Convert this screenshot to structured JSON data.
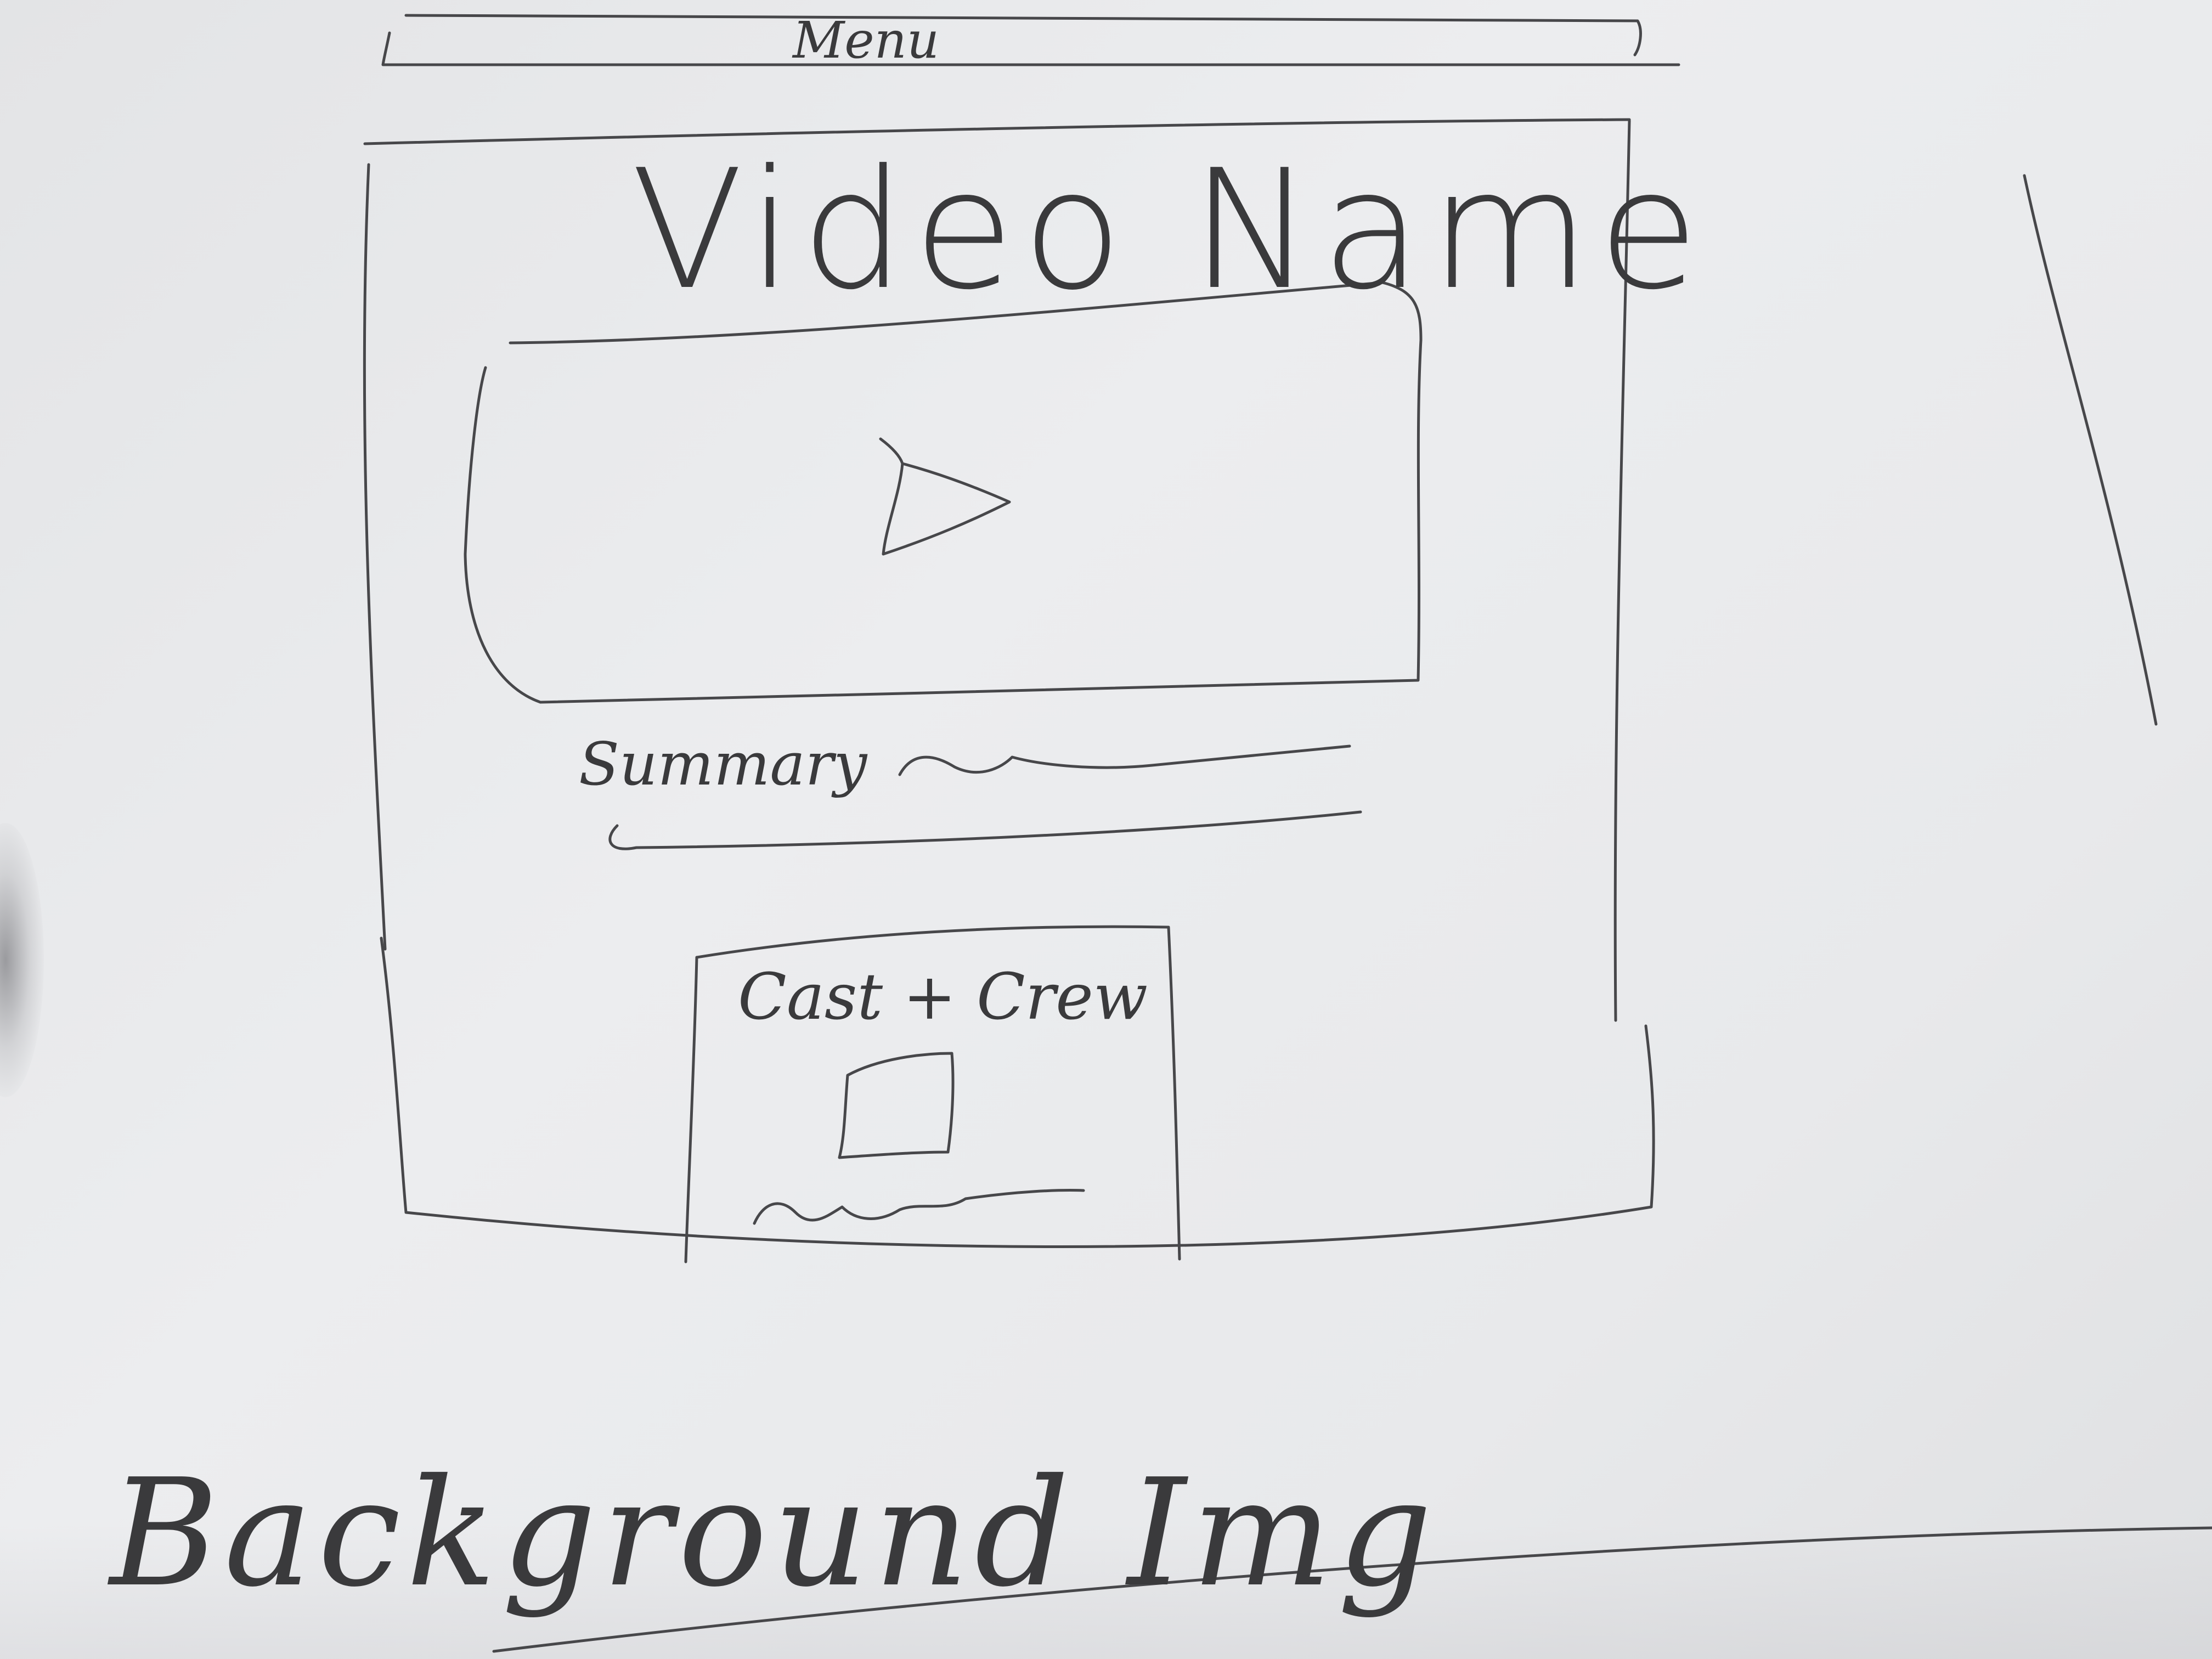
{
  "sketch": {
    "menu_label": "Menu",
    "video_title": "Video Name",
    "summary_label": "Summary",
    "cast_crew_label": "Cast + Crew",
    "background_label": "Background Img"
  },
  "icons": {
    "play": "play-icon",
    "cast_photo": "image-placeholder-icon"
  },
  "colors": {
    "paper": "#e9eaec",
    "pencil": "#47474a"
  }
}
